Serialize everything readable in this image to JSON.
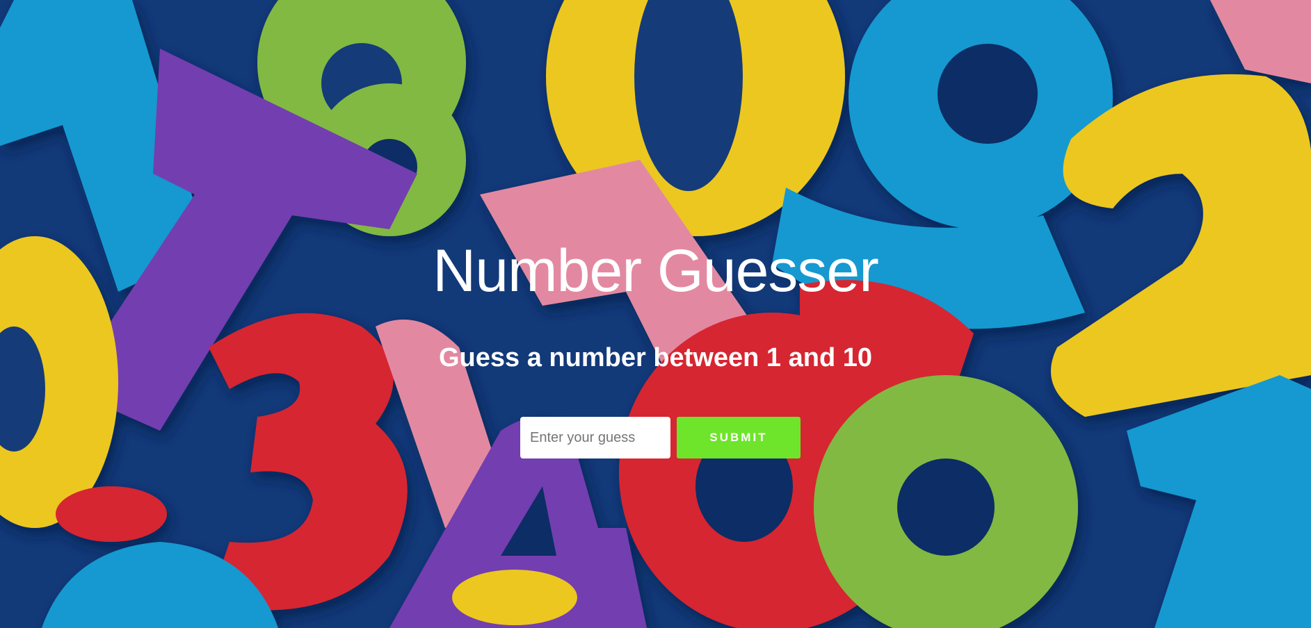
{
  "page": {
    "title": "Number Guesser",
    "subtitle": "Guess a number between 1 and 10"
  },
  "form": {
    "input_placeholder": "Enter your guess",
    "input_value": "",
    "submit_label": "SUBMIT"
  },
  "theme": {
    "submit_color": "#6ee52a",
    "background_image": "colorful-foam-numbers"
  }
}
